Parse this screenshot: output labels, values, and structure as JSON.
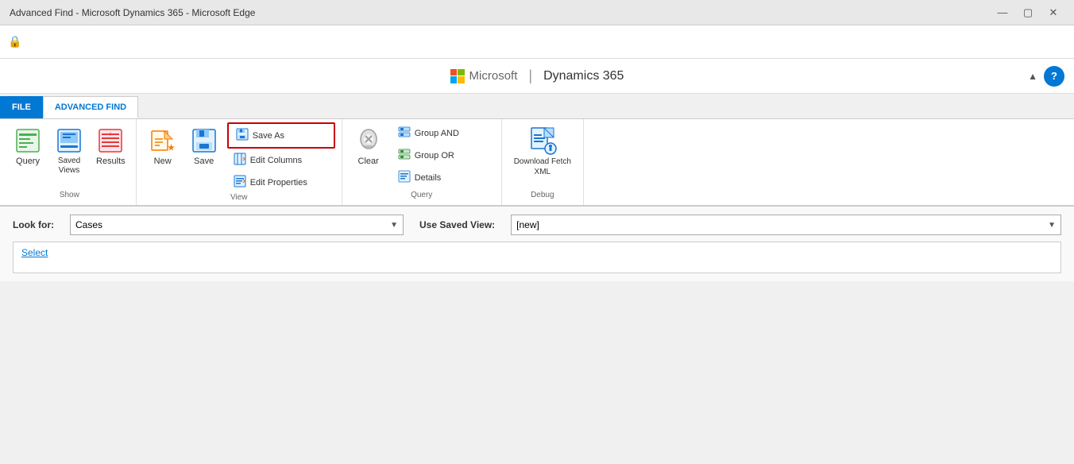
{
  "titleBar": {
    "title": "Advanced Find - Microsoft Dynamics 365 - Microsoft Edge",
    "minBtn": "—",
    "maxBtn": "▢",
    "closeBtn": "✕"
  },
  "addressBar": {
    "lockIcon": "🔒"
  },
  "appHeader": {
    "msText": "Microsoft",
    "divider": "|",
    "dynamicsText": "Dynamics 365",
    "helpLabel": "?"
  },
  "tabs": {
    "fileLabel": "FILE",
    "advancedFindLabel": "ADVANCED FIND"
  },
  "ribbon": {
    "show": {
      "groupLabel": "Show",
      "queryLabel": "Query",
      "savedViewsLabel": "Saved\nViews",
      "resultsLabel": "Results"
    },
    "view": {
      "groupLabel": "View",
      "newLabel": "New",
      "saveLabel": "Save",
      "saveAsLabel": "Save As",
      "editColumnsLabel": "Edit Columns",
      "editPropertiesLabel": "Edit Properties"
    },
    "query": {
      "groupLabel": "Query",
      "clearLabel": "Clear",
      "groupAndLabel": "Group AND",
      "groupOrLabel": "Group OR",
      "detailsLabel": "Details"
    },
    "debug": {
      "groupLabel": "Debug",
      "downloadFetchXmlLabel": "Download Fetch\nXML"
    }
  },
  "content": {
    "lookForLabel": "Look for:",
    "lookForValue": "Cases",
    "useSavedViewLabel": "Use Saved View:",
    "useSavedViewValue": "[new]",
    "selectLink": "Select"
  }
}
